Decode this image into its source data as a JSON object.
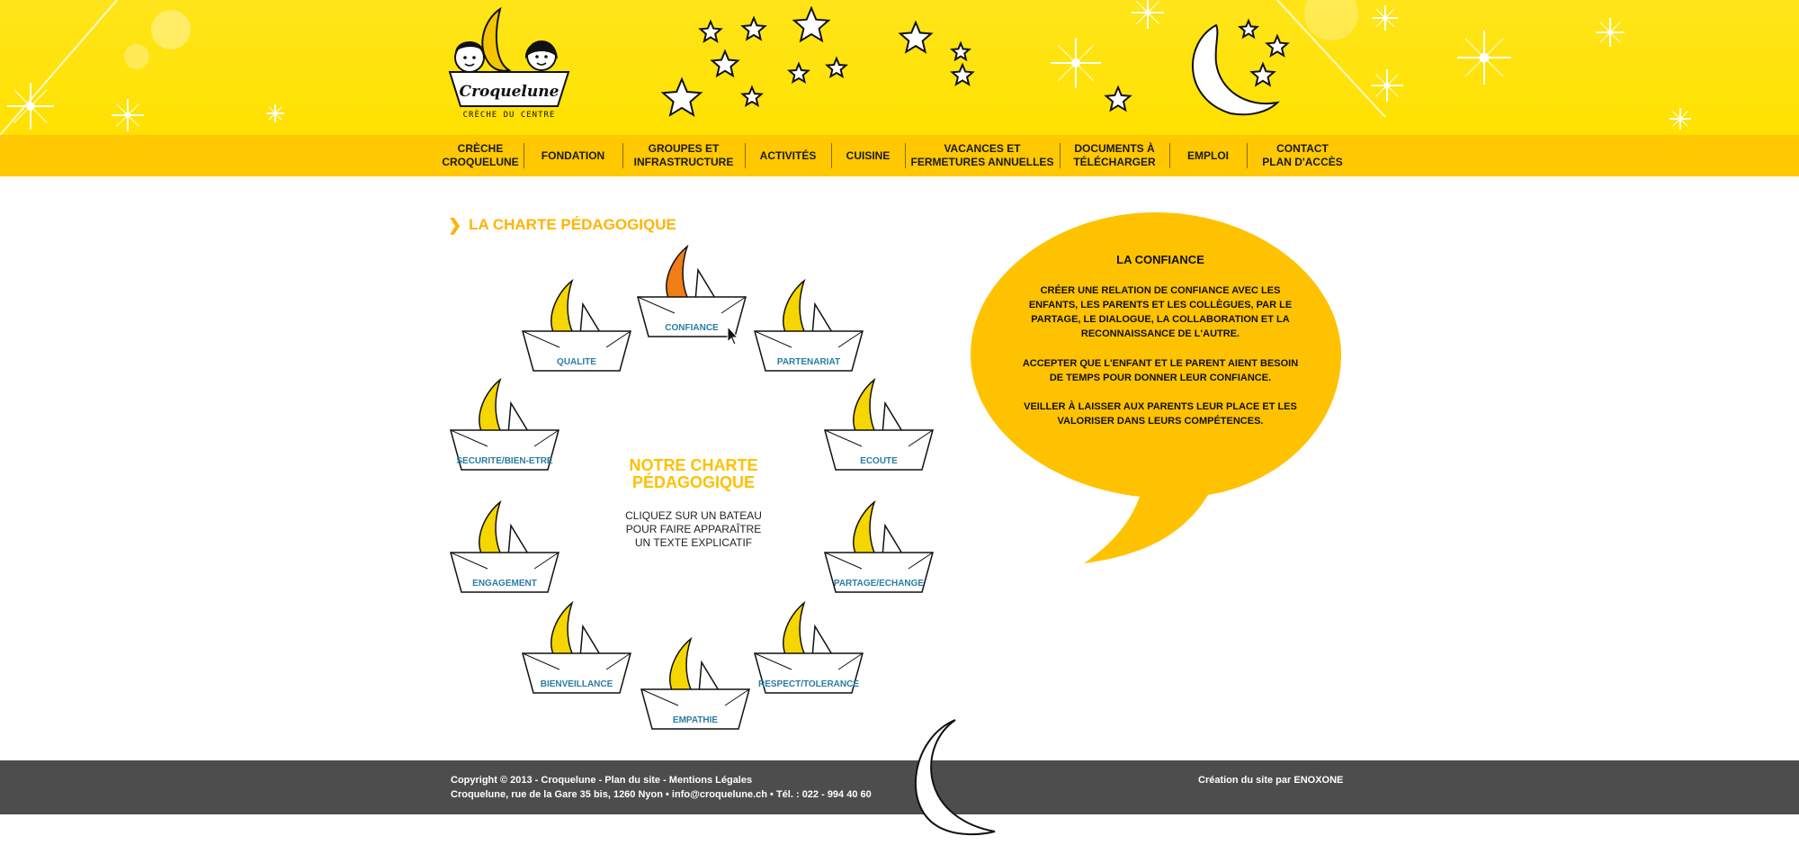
{
  "brand": {
    "name": "Croquelune",
    "subtitle": "CRÈCHE DU CENTRE"
  },
  "nav": {
    "items": [
      {
        "line1": "CRÈCHE",
        "line2": "CROQUELUNE"
      },
      {
        "line1": "FONDATION",
        "line2": ""
      },
      {
        "line1": "GROUPES ET",
        "line2": "INFRASTRUCTURE"
      },
      {
        "line1": "ACTIVITÉS",
        "line2": ""
      },
      {
        "line1": "CUISINE",
        "line2": ""
      },
      {
        "line1": "VACANCES ET",
        "line2": "FERMETURES ANNUELLES"
      },
      {
        "line1": "DOCUMENTS À",
        "line2": "TÉLÉCHARGER"
      },
      {
        "line1": "EMPLOI",
        "line2": ""
      },
      {
        "line1": "CONTACT",
        "line2": "PLAN  D'ACCÈS"
      }
    ]
  },
  "page": {
    "title": "LA CHARTE PÉDAGOGIQUE"
  },
  "charter": {
    "center_title_line1": "NOTRE CHARTE",
    "center_title_line2": "PÉDAGOGIQUE",
    "center_text": "CLIQUEZ SUR UN BATEAU POUR FAIRE APPARAÎTRE UN TEXTE EXPLICATIF",
    "boats": [
      {
        "label": "CONFIANCE",
        "active": true
      },
      {
        "label": "PARTENARIAT",
        "active": false
      },
      {
        "label": "ECOUTE",
        "active": false
      },
      {
        "label": "PARTAGE/ECHANGE",
        "active": false
      },
      {
        "label": "RESPECT/TOLERANCE",
        "active": false
      },
      {
        "label": "EMPATHIE",
        "active": false
      },
      {
        "label": "BIENVEILLANCE",
        "active": false
      },
      {
        "label": "ENGAGEMENT",
        "active": false
      },
      {
        "label": "SECURITE/BIEN-ETRE",
        "active": false
      },
      {
        "label": "QUALITE",
        "active": false
      }
    ]
  },
  "bubble": {
    "title": "LA CONFIANCE",
    "paragraphs": [
      "CRÉER UNE RELATION DE CONFIANCE AVEC LES ENFANTS, LES PARENTS ET LES COLLÈGUES, PAR LE PARTAGE, LE DIALOGUE, LA COLLABORATION ET LA RECONNAISSANCE DE L'AUTRE.",
      "ACCEPTER QUE L'ENFANT ET LE PARENT AIENT BESOIN DE TEMPS POUR DONNER LEUR CONFIANCE.",
      "VEILLER À LAISSER AUX PARENTS LEUR PLACE ET LES VALORISER DANS LEURS COMPÉTENCES."
    ]
  },
  "footer": {
    "line1": "Copyright © 2013 - Croquelune - Plan du site - Mentions Légales",
    "line2": "Croquelune, rue de la Gare 35 bis, 1260 Nyon • info@croquelune.ch • Tél. : 022 - 994 40 60",
    "credit": "Création du site par ENOXONE"
  },
  "colors": {
    "header_yellow": "#ffe400",
    "nav_yellow": "#ffc800",
    "accent_orange": "#ffb400",
    "active_sail": "#f07d16",
    "boat_label": "#2a7da3",
    "footer_gray": "#4d4d4d"
  },
  "icons": [
    "star-icon",
    "moon-icon",
    "sparkle-icon",
    "chevron-right-icon",
    "boat-icon",
    "cursor-icon"
  ]
}
